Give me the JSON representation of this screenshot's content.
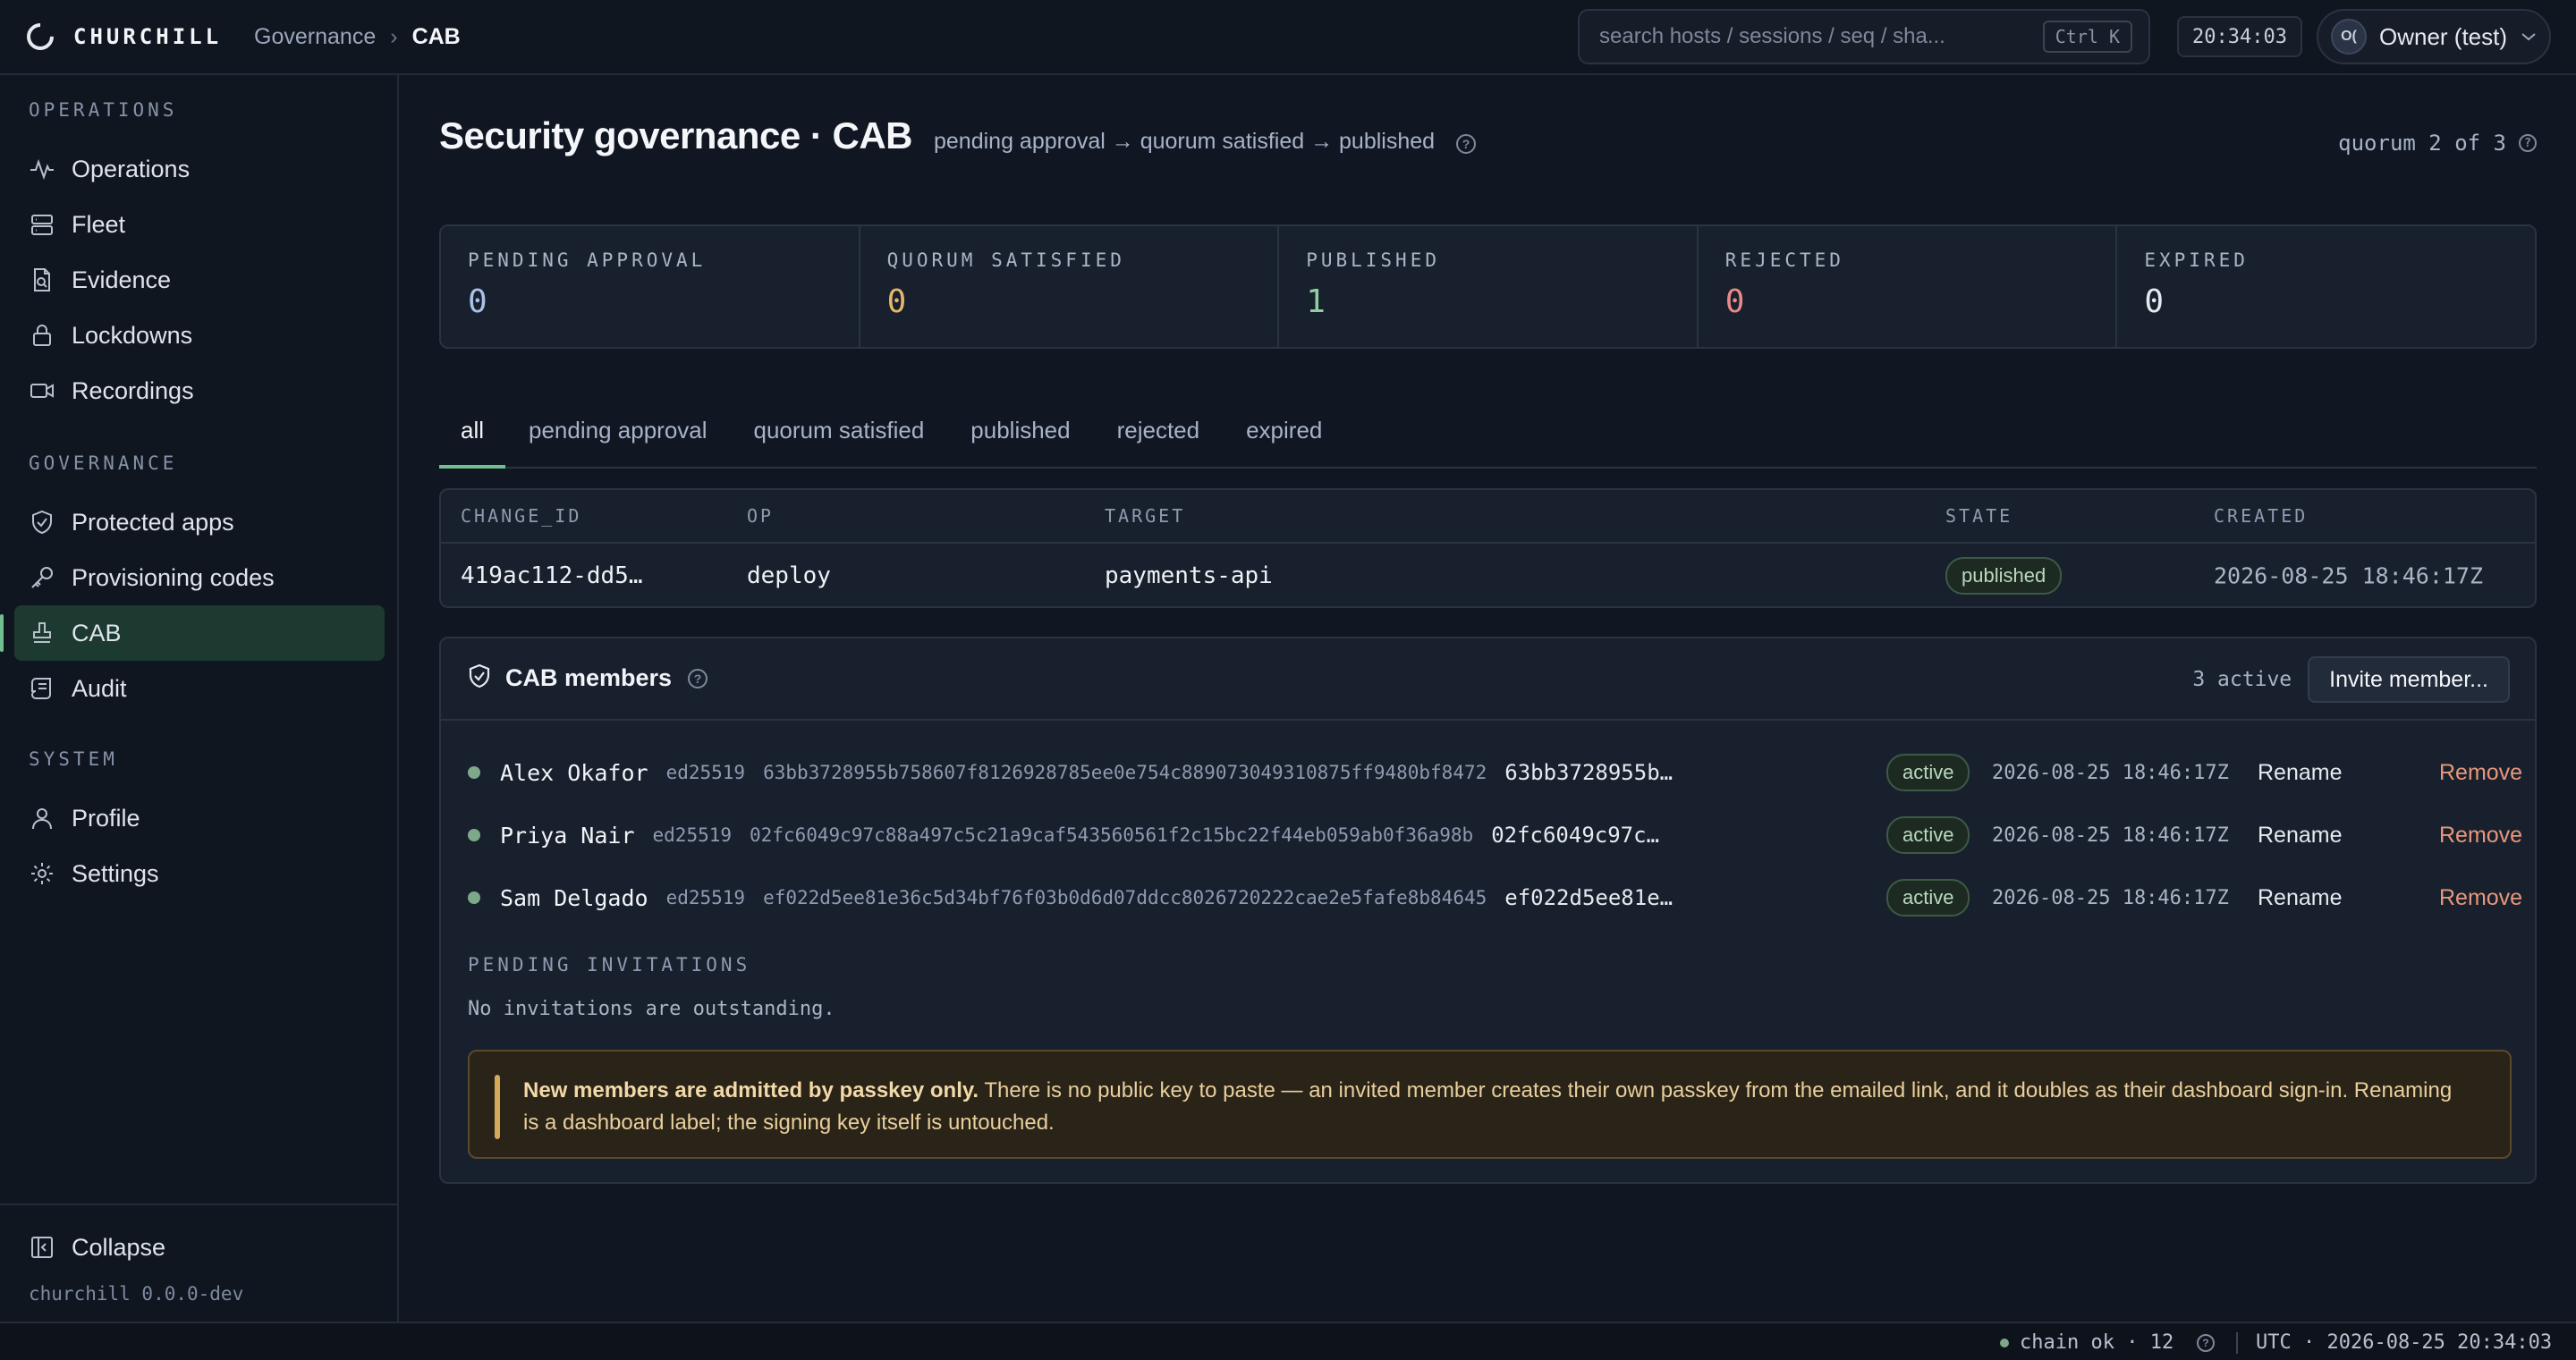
{
  "brand": {
    "name": "CHURCHILL"
  },
  "breadcrumb": {
    "parent": "Governance",
    "separator": "›",
    "current": "CAB"
  },
  "search": {
    "placeholder": "search hosts / sessions / seq / sha...",
    "shortcut": "Ctrl K"
  },
  "clock": "20:34:03",
  "user": {
    "initials": "O(",
    "name": "Owner (test)"
  },
  "sidebar": {
    "sections": [
      {
        "label": "OPERATIONS",
        "items": [
          {
            "label": "Operations",
            "icon": "activity-icon"
          },
          {
            "label": "Fleet",
            "icon": "server-icon"
          },
          {
            "label": "Evidence",
            "icon": "file-search-icon"
          },
          {
            "label": "Lockdowns",
            "icon": "lock-icon"
          },
          {
            "label": "Recordings",
            "icon": "video-icon"
          }
        ]
      },
      {
        "label": "GOVERNANCE",
        "items": [
          {
            "label": "Protected apps",
            "icon": "shield-check-icon"
          },
          {
            "label": "Provisioning codes",
            "icon": "key-icon"
          },
          {
            "label": "CAB",
            "icon": "stamp-icon",
            "active": true
          },
          {
            "label": "Audit",
            "icon": "scroll-icon"
          }
        ]
      },
      {
        "label": "SYSTEM",
        "items": [
          {
            "label": "Profile",
            "icon": "user-icon"
          },
          {
            "label": "Settings",
            "icon": "gear-icon"
          }
        ]
      }
    ],
    "collapse_label": "Collapse",
    "version": "churchill 0.0.0-dev"
  },
  "page": {
    "title": "Security governance · CAB",
    "subtitle": "pending approval → quorum satisfied → published",
    "quorum": "quorum 2 of 3"
  },
  "stats": [
    {
      "label": "PENDING APPROVAL",
      "value": "0",
      "color": "#a9c2e8"
    },
    {
      "label": "QUORUM SATISFIED",
      "value": "0",
      "color": "#e3b86a"
    },
    {
      "label": "PUBLISHED",
      "value": "1",
      "color": "#8fcf9f"
    },
    {
      "label": "REJECTED",
      "value": "0",
      "color": "#e88a86"
    },
    {
      "label": "EXPIRED",
      "value": "0",
      "color": "#e6e9ef"
    }
  ],
  "tabs": [
    "all",
    "pending approval",
    "quorum satisfied",
    "published",
    "rejected",
    "expired"
  ],
  "changes": {
    "columns": [
      "CHANGE_ID",
      "OP",
      "TARGET",
      "STATE",
      "CREATED"
    ],
    "rows": [
      {
        "change_id": "419ac112-dd5…",
        "op": "deploy",
        "target": "payments-api",
        "state": "published",
        "created": "2026-08-25 18:46:17Z"
      }
    ]
  },
  "members": {
    "title": "CAB members",
    "active_count": "3 active",
    "invite_label": "Invite member...",
    "rows": [
      {
        "name": "Alex Okafor",
        "algo": "ed25519",
        "key": "63bb3728955b758607f8126928785ee0e754c889073049310875ff9480bf8472",
        "short": "63bb3728955b…",
        "state": "active",
        "date": "2026-08-25 18:46:17Z",
        "rename": "Rename",
        "remove": "Remove"
      },
      {
        "name": "Priya Nair",
        "algo": "ed25519",
        "key": "02fc6049c97c88a497c5c21a9caf543560561f2c15bc22f44eb059ab0f36a98b",
        "short": "02fc6049c97c…",
        "state": "active",
        "date": "2026-08-25 18:46:17Z",
        "rename": "Rename",
        "remove": "Remove"
      },
      {
        "name": "Sam Delgado",
        "algo": "ed25519",
        "key": "ef022d5ee81e36c5d34bf76f03b0d6d07ddcc8026720222cae2e5fafe8b84645",
        "short": "ef022d5ee81e…",
        "state": "active",
        "date": "2026-08-25 18:46:17Z",
        "rename": "Rename",
        "remove": "Remove"
      }
    ],
    "pending_title": "PENDING INVITATIONS",
    "pending_empty": "No invitations are outstanding.",
    "note_strong": "New members are admitted by passkey only.",
    "note_text": " There is no public key to paste — an invited member creates their own passkey from the emailed link, and it doubles as their dashboard sign-in. Renaming is a dashboard label; the signing key itself is untouched."
  },
  "statusbar": {
    "chain": "chain ok · 12",
    "time": "UTC · 2026-08-25 20:34:03"
  }
}
